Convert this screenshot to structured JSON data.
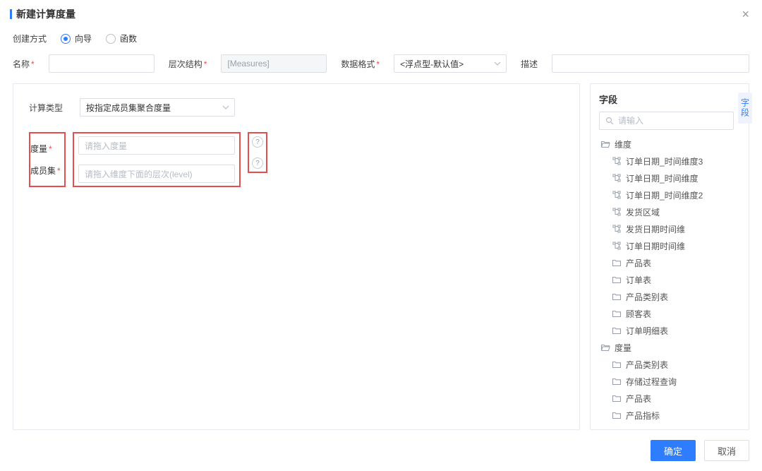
{
  "dialog": {
    "title": "新建计算度量"
  },
  "createMode": {
    "label": "创建方式",
    "options": {
      "wizard": "向导",
      "function": "函数"
    },
    "selected": "wizard"
  },
  "form": {
    "name_label": "名称",
    "hierarchy_label": "层次结构",
    "hierarchy_value": "[Measures]",
    "dataformat_label": "数据格式",
    "dataformat_value": "<浮点型-默认值>",
    "desc_label": "描述"
  },
  "calc": {
    "type_label": "计算类型",
    "type_value": "按指定成员集聚合度量",
    "measure_label": "度量",
    "measure_placeholder": "请拖入度量",
    "memberset_label": "成员集",
    "memberset_placeholder": "请拖入维度下面的层次(level)"
  },
  "fieldsPanel": {
    "title": "字段",
    "tab": "字段",
    "search_placeholder": "请输入",
    "nodes": [
      {
        "level": 0,
        "icon": "folder-open",
        "label": "维度"
      },
      {
        "level": 1,
        "icon": "hier",
        "label": "订单日期_时间维度3"
      },
      {
        "level": 1,
        "icon": "hier",
        "label": "订单日期_时间维度"
      },
      {
        "level": 1,
        "icon": "hier",
        "label": "订单日期_时间维度2"
      },
      {
        "level": 1,
        "icon": "hier",
        "label": "发货区域"
      },
      {
        "level": 1,
        "icon": "hier",
        "label": "发货日期时间维"
      },
      {
        "level": 1,
        "icon": "hier",
        "label": "订单日期时间维"
      },
      {
        "level": 1,
        "icon": "folder",
        "label": "产品表"
      },
      {
        "level": 1,
        "icon": "folder",
        "label": "订单表"
      },
      {
        "level": 1,
        "icon": "folder",
        "label": "产品类别表"
      },
      {
        "level": 1,
        "icon": "folder",
        "label": "顾客表"
      },
      {
        "level": 1,
        "icon": "folder",
        "label": "订单明细表"
      },
      {
        "level": 0,
        "icon": "folder-open",
        "label": "度量"
      },
      {
        "level": 1,
        "icon": "folder",
        "label": "产品类别表"
      },
      {
        "level": 1,
        "icon": "folder",
        "label": "存储过程查询"
      },
      {
        "level": 1,
        "icon": "folder",
        "label": "产品表"
      },
      {
        "level": 1,
        "icon": "folder",
        "label": "产品指标"
      }
    ]
  },
  "footer": {
    "ok": "确定",
    "cancel": "取消"
  }
}
